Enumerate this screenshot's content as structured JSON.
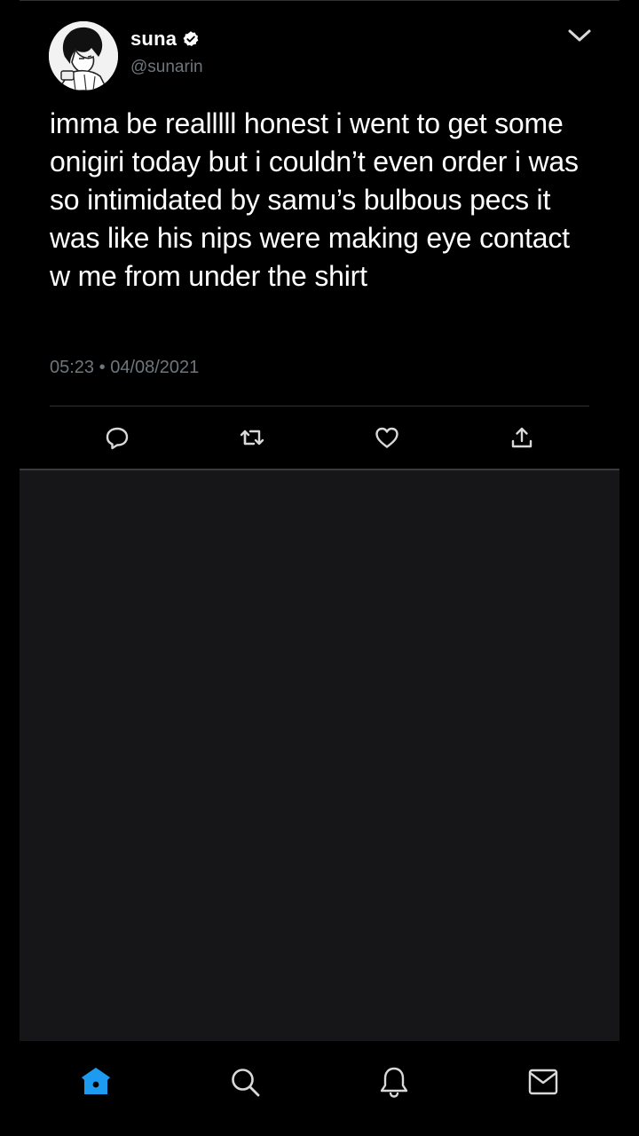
{
  "tweet": {
    "display_name": "suna",
    "handle": "@sunarin",
    "text": "imma be realllll honest i went to get some onigiri today but i couldn’t even order i was so intimidated by samu’s bulbous pecs it was like his nips were making eye contact w me from under the shirt",
    "time": "05:23",
    "separator": "•",
    "date": "04/08/2021"
  },
  "icons": {
    "verified": "verified-badge-icon",
    "caret": "chevron-down-icon",
    "reply": "reply-icon",
    "retweet": "retweet-icon",
    "like": "heart-icon",
    "share": "share-icon",
    "home": "home-icon",
    "search": "search-icon",
    "notifications": "bell-icon",
    "messages": "mail-icon"
  },
  "colors": {
    "background": "#000000",
    "text": "#ffffff",
    "secondary_text": "#6e767d",
    "divider": "#2f3336",
    "empty_panel": "#161618",
    "accent": "#1d9bf0",
    "icon": "#d9d9d9"
  }
}
